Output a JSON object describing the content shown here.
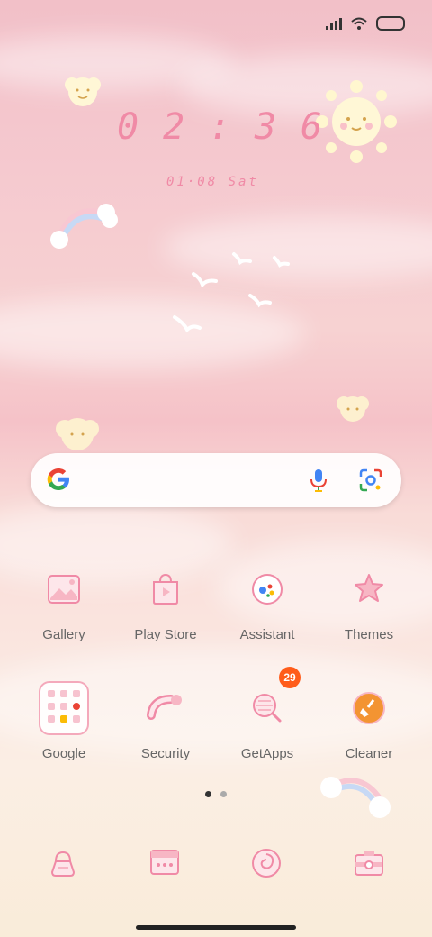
{
  "status_bar": {
    "signal": "signal-icon",
    "wifi": "wifi-icon",
    "battery": "battery-icon"
  },
  "clock": {
    "h1": "0",
    "h2": "2",
    "sep": ":",
    "m1": "3",
    "m2": "6",
    "date": "01·08 Sat"
  },
  "search": {
    "google_logo": "google-g-icon",
    "mic": "mic-icon",
    "lens": "lens-icon"
  },
  "apps": [
    {
      "label": "Gallery",
      "icon": "gallery-icon"
    },
    {
      "label": "Play Store",
      "icon": "play-store-icon"
    },
    {
      "label": "Assistant",
      "icon": "assistant-icon"
    },
    {
      "label": "Themes",
      "icon": "themes-icon"
    },
    {
      "label": "Google",
      "icon": "google-folder-icon"
    },
    {
      "label": "Security",
      "icon": "security-icon"
    },
    {
      "label": "GetApps",
      "icon": "getapps-icon",
      "badge": "29"
    },
    {
      "label": "Cleaner",
      "icon": "cleaner-icon"
    }
  ],
  "pages": {
    "count": 2,
    "current": 1
  },
  "dock": [
    "phone-icon",
    "messages-icon",
    "browser-icon",
    "camera-icon"
  ],
  "colors": {
    "accent": "#f08aa6",
    "badge": "#ff5c1a",
    "icon_pink": "#f4a9bb"
  }
}
